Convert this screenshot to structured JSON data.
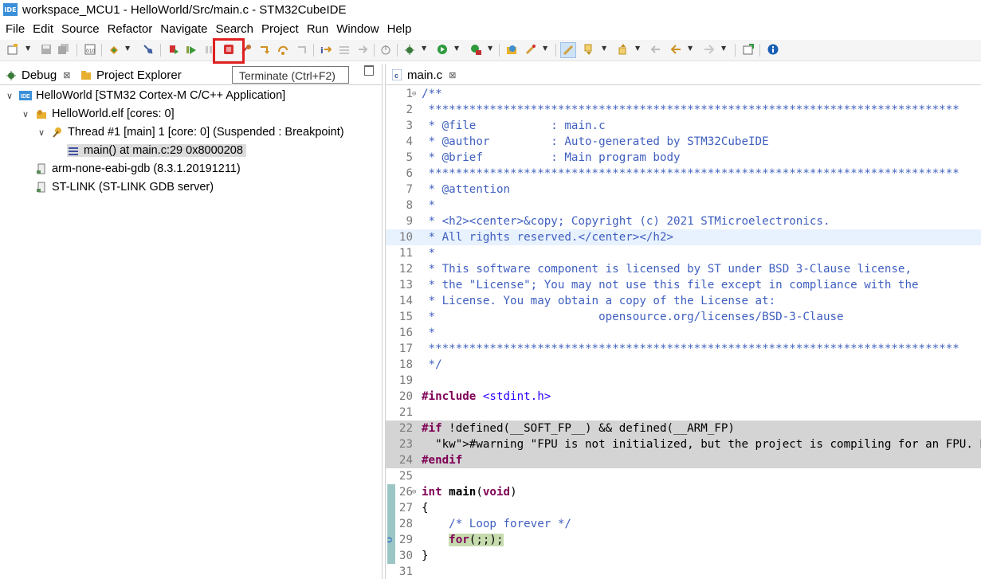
{
  "window": {
    "title": "workspace_MCU1 - HelloWorld/Src/main.c - STM32CubeIDE",
    "badge": "IDE"
  },
  "menu": [
    "File",
    "Edit",
    "Source",
    "Refactor",
    "Navigate",
    "Search",
    "Project",
    "Run",
    "Window",
    "Help"
  ],
  "tooltip": "Terminate (Ctrl+F2)",
  "left_tabs": {
    "debug": "Debug",
    "project_explorer": "Project Explorer"
  },
  "tree": [
    {
      "label": "HelloWorld [STM32 Cortex-M C/C++ Application]",
      "icon": "ide-launch-icon",
      "level": 0
    },
    {
      "label": "HelloWorld.elf [cores: 0]",
      "icon": "debug-target-icon",
      "level": 1
    },
    {
      "label": "Thread #1 [main] 1 [core: 0] (Suspended : Breakpoint)",
      "icon": "thread-icon",
      "level": 2
    },
    {
      "label": "main() at main.c:29 0x8000208",
      "icon": "stack-frame-icon",
      "level": 3
    },
    {
      "label": "arm-none-eabi-gdb (8.3.1.20191211)",
      "icon": "process-icon",
      "level": 1
    },
    {
      "label": "ST-LINK (ST-LINK GDB server)",
      "icon": "process-icon",
      "level": 1
    }
  ],
  "editor": {
    "tab": "main.c",
    "lines": [
      {
        "n": "1",
        "t": "/**"
      },
      {
        "n": "2",
        "t": " ******************************************************************************"
      },
      {
        "n": "3",
        "t": " * @file           : main.c"
      },
      {
        "n": "4",
        "t": " * @author         : Auto-generated by STM32CubeIDE"
      },
      {
        "n": "5",
        "t": " * @brief          : Main program body"
      },
      {
        "n": "6",
        "t": " ******************************************************************************"
      },
      {
        "n": "7",
        "t": " * @attention"
      },
      {
        "n": "8",
        "t": " *"
      },
      {
        "n": "9",
        "t": " * <h2><center>&copy; Copyright (c) 2021 STMicroelectronics."
      },
      {
        "n": "10",
        "t": " * All rights reserved.</center></h2>"
      },
      {
        "n": "11",
        "t": " *"
      },
      {
        "n": "12",
        "t": " * This software component is licensed by ST under BSD 3-Clause license,"
      },
      {
        "n": "13",
        "t": " * the \"License\"; You may not use this file except in compliance with the"
      },
      {
        "n": "14",
        "t": " * License. You may obtain a copy of the License at:"
      },
      {
        "n": "15",
        "t": " *                        opensource.org/licenses/BSD-3-Clause"
      },
      {
        "n": "16",
        "t": " *"
      },
      {
        "n": "17",
        "t": " ******************************************************************************"
      },
      {
        "n": "18",
        "t": " */"
      },
      {
        "n": "19",
        "t": ""
      },
      {
        "n": "20",
        "t": "#include <stdint.h>"
      },
      {
        "n": "21",
        "t": ""
      },
      {
        "n": "22",
        "t": "#if !defined(__SOFT_FP__) && defined(__ARM_FP)"
      },
      {
        "n": "23",
        "t": "  #warning \"FPU is not initialized, but the project is compiling for an FPU. P"
      },
      {
        "n": "24",
        "t": "#endif"
      },
      {
        "n": "25",
        "t": ""
      },
      {
        "n": "26",
        "t": "int main(void)"
      },
      {
        "n": "27",
        "t": "{"
      },
      {
        "n": "28",
        "t": "    /* Loop forever */"
      },
      {
        "n": "29",
        "t": "    for(;;);"
      },
      {
        "n": "30",
        "t": "}"
      },
      {
        "n": "31",
        "t": ""
      }
    ]
  }
}
